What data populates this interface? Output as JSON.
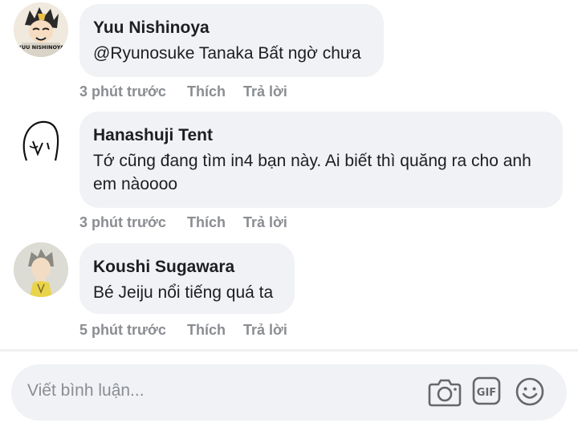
{
  "comments": [
    {
      "author": "Yuu Nishinoya",
      "text": "@Ryunosuke Tanaka Bất ngờ chưa",
      "avatar_caption": "YUU NISHINOYA",
      "time": "3 phút trước",
      "like": "Thích",
      "reply": "Trả lời"
    },
    {
      "author": "Hanashuji Tent",
      "text": "Tớ cũng đang tìm in4 bạn này. Ai biết thì quăng ra cho anh em nàoooo",
      "time": "3 phút trước",
      "like": "Thích",
      "reply": "Trả lời"
    },
    {
      "author": "Koushi Sugawara",
      "text": "Bé Jeiju nổi tiếng quá ta",
      "time": "5 phút trước",
      "like": "Thích",
      "reply": "Trả lời"
    }
  ],
  "composer": {
    "placeholder": "Viết bình luận...",
    "icons": [
      "camera-icon",
      "gif-icon",
      "smiley-icon"
    ],
    "gif_label": "GIF"
  },
  "colors": {
    "bubble": "#f0f2f5",
    "meta_text": "#8a8d91",
    "text": "#1c1e21"
  }
}
